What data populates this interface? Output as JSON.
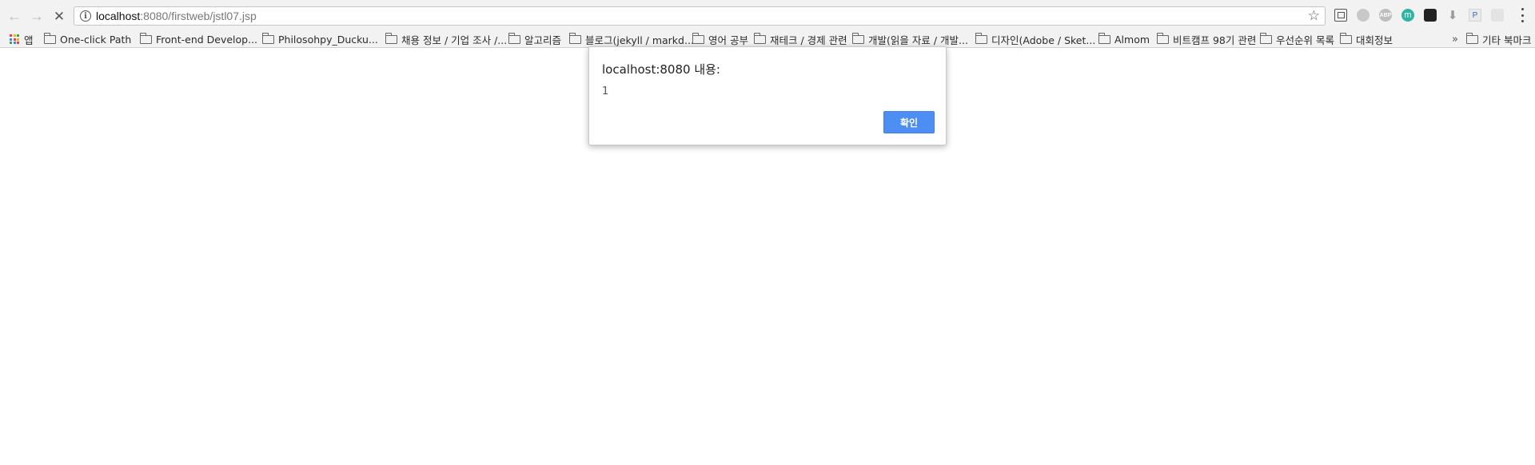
{
  "toolbar": {
    "back_icon": "arrow-left-icon",
    "forward_icon": "arrow-right-icon",
    "stop_icon": "close-icon",
    "url_host": "localhost",
    "url_rest": ":8080/firstweb/jstl07.jsp",
    "bookmark_star_icon": "star-icon",
    "extensions": [
      "cast-icon",
      "extension-icon",
      "adblock-icon",
      "m-extension-icon",
      "dark-extension-icon",
      "download-icon",
      "paper-extension-icon",
      "extension-icon",
      "menu-icon"
    ],
    "m_label": "m",
    "abp_label": "ABP"
  },
  "bookmarks": {
    "apps_label": "앱",
    "items": [
      "One-click Path",
      "Front-end Develop...",
      "Philosohpy_Ducku...",
      "채용 정보 / 기업 조사 /...",
      "알고리즘",
      "블로그(jekyll / markd...",
      "영어 공부",
      "재테크 / 경제 관련",
      "개발(읽을 자료 / 개발...",
      "디자인(Adobe / Sket...",
      "Almom",
      "비트캠프 98기 관련",
      "우선순위 목록",
      "대회정보"
    ],
    "overflow_label": "»",
    "other_label": "기타 북마크"
  },
  "dialog": {
    "title": "localhost:8080 내용:",
    "message": "1",
    "ok_label": "확인"
  },
  "colors": {
    "accent": "#4d8ef5",
    "toolbar_bg": "#f2f2f2"
  }
}
